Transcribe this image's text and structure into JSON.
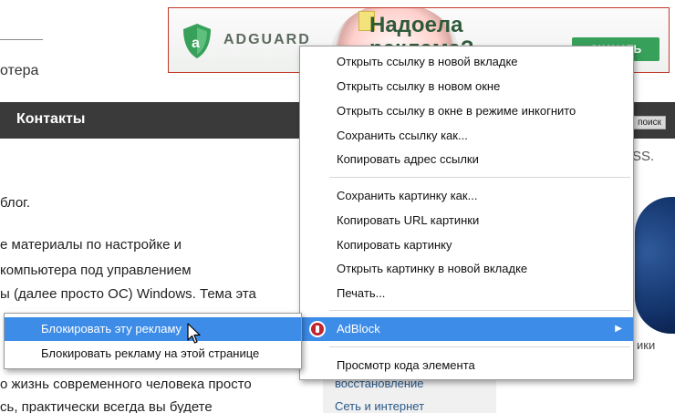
{
  "page": {
    "site_line": "отера",
    "nav_item": "Контакты",
    "search_button": "поиск",
    "rss_text": "SS.",
    "article_lines": [
      "блог.",
      "е материалы по настройке и",
      "компьютера под управлением",
      "ы (далее просто ОС) Windows. Тема эта",
      "о жизнь современного человека просто",
      "сь, практически всегда вы будете"
    ],
    "sidebar_links": [
      "восстановление",
      "Сеть и интернет"
    ],
    "sidebar_word": "ики"
  },
  "ad": {
    "brand": "ADGUARD",
    "headline_line1": "Надоела",
    "headline_line2": "реклама?",
    "button": "СКАЧАТЬ",
    "colors": {
      "border": "#c0392b",
      "brand_green": "#37a05a",
      "headline": "#2f5a3a"
    }
  },
  "context_menu": {
    "group1": [
      "Открыть ссылку в новой вкладке",
      "Открыть ссылку в новом окне",
      "Открыть ссылку в окне в режиме инкогнито",
      "Сохранить ссылку как...",
      "Копировать адрес ссылки"
    ],
    "group2": [
      "Сохранить картинку как...",
      "Копировать URL картинки",
      "Копировать картинку",
      "Открыть картинку в новой вкладке",
      "Печать..."
    ],
    "adblock_label": "AdBlock",
    "adblock_icon": "adblock-icon",
    "inspect": "Просмотр кода элемента",
    "highlight_color": "#3d8ce8"
  },
  "submenu": {
    "items": [
      "Блокировать эту рекламу",
      "Блокировать рекламу на этой странице"
    ]
  }
}
